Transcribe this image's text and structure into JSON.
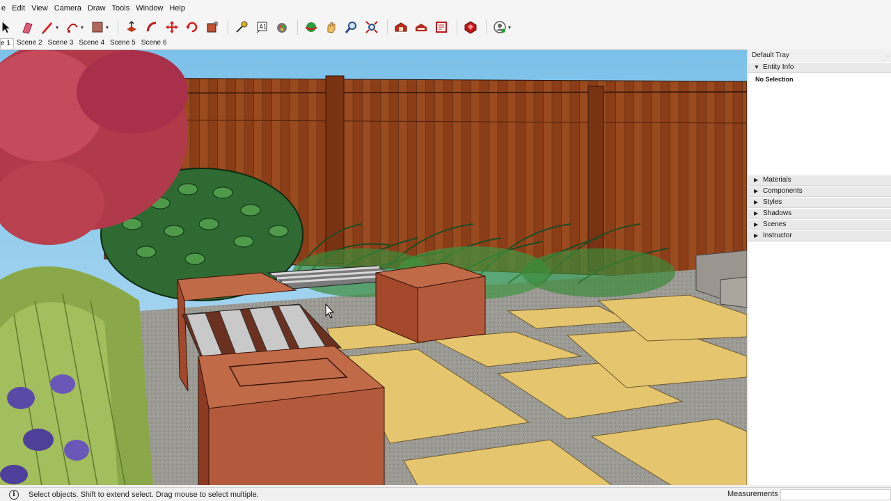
{
  "menubar": {
    "items": [
      "e",
      "Edit",
      "View",
      "Camera",
      "Draw",
      "Tools",
      "Window",
      "Help"
    ]
  },
  "toolbar": {
    "tools": [
      "select-tool",
      "eraser-tool",
      "pencil-line-tool",
      "arc-tool",
      "rectangle-tool",
      "push-pull-tool",
      "follow-me-tool",
      "move-tool",
      "rotate-tool",
      "scale-tool",
      "tape-measure-tool",
      "text-tool",
      "paint-bucket-tool",
      "orbit-tool",
      "pan-tool",
      "zoom-tool",
      "zoom-extents-tool",
      "warehouse-tool",
      "extension-warehouse-tool",
      "layout-tool",
      "extension-manager-tool",
      "user-tool"
    ]
  },
  "scenes": {
    "tabs": [
      "e 1",
      "Scene 2",
      "Scene 3",
      "Scene 4",
      "Scene 5",
      "Scene 6"
    ],
    "active_index": 0
  },
  "tray": {
    "title": "Default Tray",
    "pin": "∙",
    "entity_info": {
      "label": "Entity Info",
      "body": "No Selection",
      "expanded": true
    },
    "panels": [
      "Materials",
      "Components",
      "Styles",
      "Shadows",
      "Scenes",
      "Instructor"
    ],
    "expanded_marker": "▼",
    "collapsed_marker": "▶"
  },
  "statusbar": {
    "info": "i",
    "hint": "Select objects. Shift to extend select. Drag mouse to select multiple.",
    "measurements_label": "Measurements",
    "measurements_value": ""
  },
  "colors": {
    "sky": "#86c6ea",
    "fence": "#8a3d17",
    "bench_wood": "#b45a3c",
    "paver": "#e6c56f",
    "gravel": "#9a9a94"
  }
}
